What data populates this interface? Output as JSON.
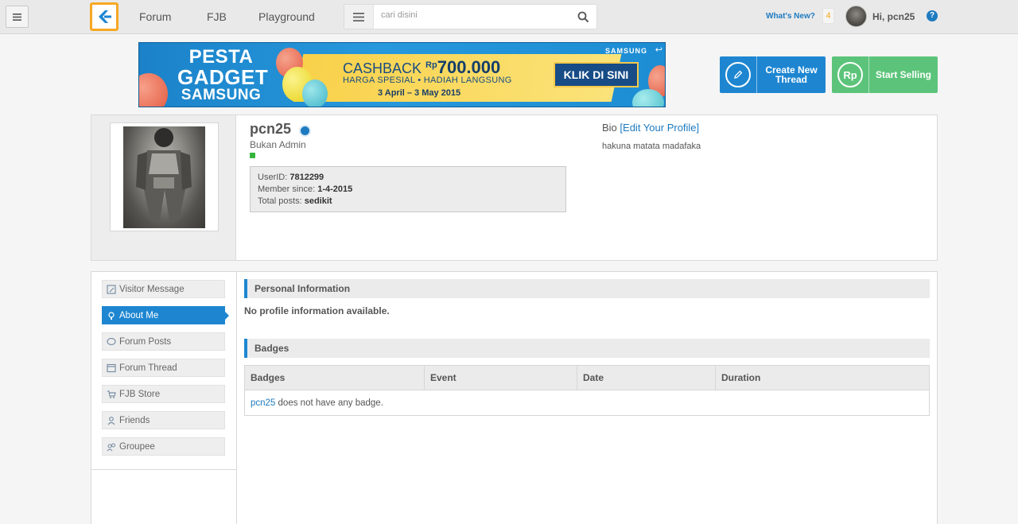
{
  "nav": {
    "links": [
      "Forum",
      "FJB",
      "Playground"
    ],
    "search_placeholder": "cari disini",
    "whats_new": "What's New?",
    "notif_count": "4",
    "greeting": "Hi, pcn25",
    "help": "?"
  },
  "banner": {
    "title_1": "PESTA",
    "title_2": "GADGET",
    "title_3": "SAMSUNG",
    "cashback_prefix": "CASHBACK",
    "cashback_currency": "Rp",
    "cashback_amount": "700.000",
    "harga": "HARGA SPESIAL • HADIAH LANGSUNG",
    "dates": "3 April – 3 May 2015",
    "cta": "KLIK DI SINI",
    "brand": "SAMSUNG"
  },
  "actions": {
    "create_line1": "Create New",
    "create_line2": "Thread",
    "sell": "Start Selling",
    "sell_icon": "Rp"
  },
  "profile": {
    "username": "pcn25",
    "rank": "Bukan Admin",
    "userid_label": "UserID:",
    "userid": "7812299",
    "member_since_label": "Member since:",
    "member_since": "1-4-2015",
    "posts_label": "Total posts:",
    "posts": "sedikit",
    "bio_label": "Bio",
    "bio_edit": "[Edit Your Profile]",
    "bio_text": "hakuna matata madafaka"
  },
  "sidebar": {
    "items": [
      {
        "label": "Visitor Message"
      },
      {
        "label": "About Me"
      },
      {
        "label": "Forum Posts"
      },
      {
        "label": "Forum Thread"
      },
      {
        "label": "FJB Store"
      },
      {
        "label": "Friends"
      },
      {
        "label": "Groupee"
      }
    ],
    "active": "About Me"
  },
  "main": {
    "personal_head": "Personal Information",
    "personal_empty": "No profile information available.",
    "badges_head": "Badges",
    "table_headers": [
      "Badges",
      "Event",
      "Date",
      "Duration"
    ],
    "empty_user": "pcn25",
    "empty_text": " does not have any badge."
  },
  "colors": {
    "accent_blue": "#1e86d1",
    "sell_green": "#5cc47a",
    "logo_orange": "#f7a823",
    "online_green": "#36b53c"
  }
}
